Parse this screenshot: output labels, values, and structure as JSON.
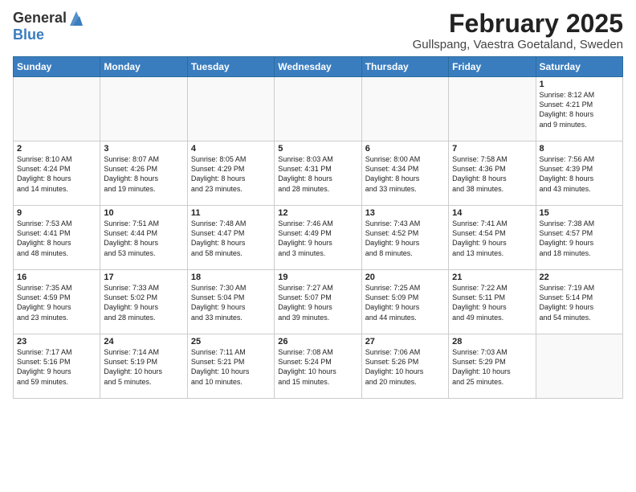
{
  "header": {
    "logo_general": "General",
    "logo_blue": "Blue",
    "month_title": "February 2025",
    "location": "Gullspang, Vaestra Goetaland, Sweden"
  },
  "weekdays": [
    "Sunday",
    "Monday",
    "Tuesday",
    "Wednesday",
    "Thursday",
    "Friday",
    "Saturday"
  ],
  "weeks": [
    [
      {
        "day": "",
        "info": ""
      },
      {
        "day": "",
        "info": ""
      },
      {
        "day": "",
        "info": ""
      },
      {
        "day": "",
        "info": ""
      },
      {
        "day": "",
        "info": ""
      },
      {
        "day": "",
        "info": ""
      },
      {
        "day": "1",
        "info": "Sunrise: 8:12 AM\nSunset: 4:21 PM\nDaylight: 8 hours\nand 9 minutes."
      }
    ],
    [
      {
        "day": "2",
        "info": "Sunrise: 8:10 AM\nSunset: 4:24 PM\nDaylight: 8 hours\nand 14 minutes."
      },
      {
        "day": "3",
        "info": "Sunrise: 8:07 AM\nSunset: 4:26 PM\nDaylight: 8 hours\nand 19 minutes."
      },
      {
        "day": "4",
        "info": "Sunrise: 8:05 AM\nSunset: 4:29 PM\nDaylight: 8 hours\nand 23 minutes."
      },
      {
        "day": "5",
        "info": "Sunrise: 8:03 AM\nSunset: 4:31 PM\nDaylight: 8 hours\nand 28 minutes."
      },
      {
        "day": "6",
        "info": "Sunrise: 8:00 AM\nSunset: 4:34 PM\nDaylight: 8 hours\nand 33 minutes."
      },
      {
        "day": "7",
        "info": "Sunrise: 7:58 AM\nSunset: 4:36 PM\nDaylight: 8 hours\nand 38 minutes."
      },
      {
        "day": "8",
        "info": "Sunrise: 7:56 AM\nSunset: 4:39 PM\nDaylight: 8 hours\nand 43 minutes."
      }
    ],
    [
      {
        "day": "9",
        "info": "Sunrise: 7:53 AM\nSunset: 4:41 PM\nDaylight: 8 hours\nand 48 minutes."
      },
      {
        "day": "10",
        "info": "Sunrise: 7:51 AM\nSunset: 4:44 PM\nDaylight: 8 hours\nand 53 minutes."
      },
      {
        "day": "11",
        "info": "Sunrise: 7:48 AM\nSunset: 4:47 PM\nDaylight: 8 hours\nand 58 minutes."
      },
      {
        "day": "12",
        "info": "Sunrise: 7:46 AM\nSunset: 4:49 PM\nDaylight: 9 hours\nand 3 minutes."
      },
      {
        "day": "13",
        "info": "Sunrise: 7:43 AM\nSunset: 4:52 PM\nDaylight: 9 hours\nand 8 minutes."
      },
      {
        "day": "14",
        "info": "Sunrise: 7:41 AM\nSunset: 4:54 PM\nDaylight: 9 hours\nand 13 minutes."
      },
      {
        "day": "15",
        "info": "Sunrise: 7:38 AM\nSunset: 4:57 PM\nDaylight: 9 hours\nand 18 minutes."
      }
    ],
    [
      {
        "day": "16",
        "info": "Sunrise: 7:35 AM\nSunset: 4:59 PM\nDaylight: 9 hours\nand 23 minutes."
      },
      {
        "day": "17",
        "info": "Sunrise: 7:33 AM\nSunset: 5:02 PM\nDaylight: 9 hours\nand 28 minutes."
      },
      {
        "day": "18",
        "info": "Sunrise: 7:30 AM\nSunset: 5:04 PM\nDaylight: 9 hours\nand 33 minutes."
      },
      {
        "day": "19",
        "info": "Sunrise: 7:27 AM\nSunset: 5:07 PM\nDaylight: 9 hours\nand 39 minutes."
      },
      {
        "day": "20",
        "info": "Sunrise: 7:25 AM\nSunset: 5:09 PM\nDaylight: 9 hours\nand 44 minutes."
      },
      {
        "day": "21",
        "info": "Sunrise: 7:22 AM\nSunset: 5:11 PM\nDaylight: 9 hours\nand 49 minutes."
      },
      {
        "day": "22",
        "info": "Sunrise: 7:19 AM\nSunset: 5:14 PM\nDaylight: 9 hours\nand 54 minutes."
      }
    ],
    [
      {
        "day": "23",
        "info": "Sunrise: 7:17 AM\nSunset: 5:16 PM\nDaylight: 9 hours\nand 59 minutes."
      },
      {
        "day": "24",
        "info": "Sunrise: 7:14 AM\nSunset: 5:19 PM\nDaylight: 10 hours\nand 5 minutes."
      },
      {
        "day": "25",
        "info": "Sunrise: 7:11 AM\nSunset: 5:21 PM\nDaylight: 10 hours\nand 10 minutes."
      },
      {
        "day": "26",
        "info": "Sunrise: 7:08 AM\nSunset: 5:24 PM\nDaylight: 10 hours\nand 15 minutes."
      },
      {
        "day": "27",
        "info": "Sunrise: 7:06 AM\nSunset: 5:26 PM\nDaylight: 10 hours\nand 20 minutes."
      },
      {
        "day": "28",
        "info": "Sunrise: 7:03 AM\nSunset: 5:29 PM\nDaylight: 10 hours\nand 25 minutes."
      },
      {
        "day": "",
        "info": ""
      }
    ]
  ]
}
